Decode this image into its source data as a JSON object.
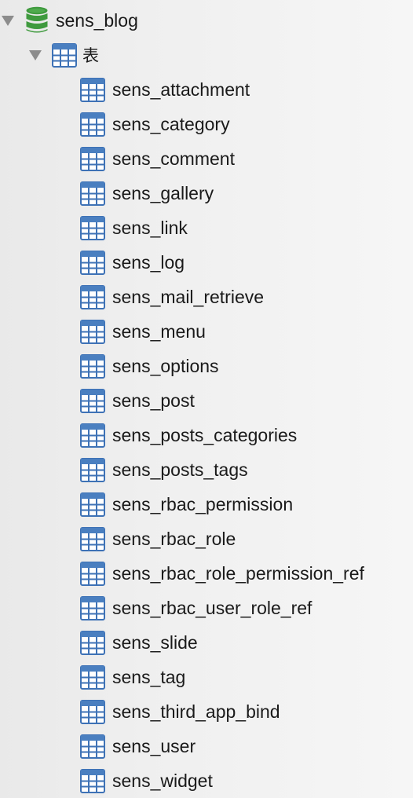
{
  "database": {
    "name": "sens_blog",
    "icon": "database-icon",
    "expanded": true,
    "color": "#3f9a3e"
  },
  "group": {
    "label": "表",
    "icon": "table-group-icon",
    "expanded": true
  },
  "tables": [
    {
      "name": "sens_attachment"
    },
    {
      "name": "sens_category"
    },
    {
      "name": "sens_comment"
    },
    {
      "name": "sens_gallery"
    },
    {
      "name": "sens_link"
    },
    {
      "name": "sens_log"
    },
    {
      "name": "sens_mail_retrieve"
    },
    {
      "name": "sens_menu"
    },
    {
      "name": "sens_options"
    },
    {
      "name": "sens_post"
    },
    {
      "name": "sens_posts_categories"
    },
    {
      "name": "sens_posts_tags"
    },
    {
      "name": "sens_rbac_permission"
    },
    {
      "name": "sens_rbac_role"
    },
    {
      "name": "sens_rbac_role_permission_ref"
    },
    {
      "name": "sens_rbac_user_role_ref"
    },
    {
      "name": "sens_slide"
    },
    {
      "name": "sens_tag"
    },
    {
      "name": "sens_third_app_bind"
    },
    {
      "name": "sens_user"
    },
    {
      "name": "sens_widget"
    }
  ],
  "table_icon": "table-icon",
  "colors": {
    "table_icon_header": "#4a7fc0",
    "table_icon_border": "#3e72b6",
    "table_icon_fill": "#ffffff",
    "disclosure": "#8c8c8c"
  }
}
